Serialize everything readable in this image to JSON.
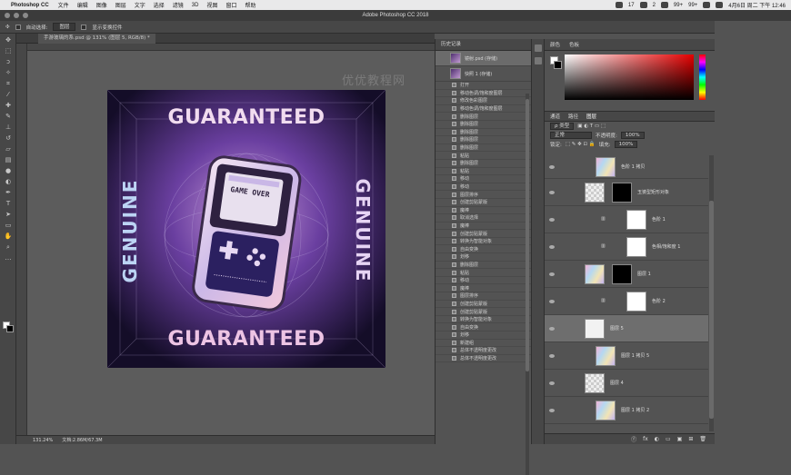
{
  "menubar": {
    "app": "Photoshop CC",
    "items": [
      "文件",
      "编辑",
      "图像",
      "图层",
      "文字",
      "选择",
      "滤镜",
      "3D",
      "视图",
      "窗口",
      "帮助"
    ],
    "status": [
      "17",
      "2",
      "99+",
      "99+"
    ],
    "clock": "4月6日 周二 下午 12:46"
  },
  "window": {
    "title": "Adobe Photoshop CC 2018"
  },
  "options": {
    "auto_select": "自动选择:",
    "layer_select": "图层",
    "show_transform": "显示变换控件"
  },
  "document": {
    "tab": "手游玻璃的系.psd @ 131% (图层 5, RGB/8) *",
    "zoom": "131.24%",
    "doc_size": "文档:2.86M/67.3M"
  },
  "artwork": {
    "top_text": "GUARANTEED",
    "bottom_text": "GUARANTEED",
    "left_text": "GENUINE",
    "right_text": "GENUINE",
    "screen_text": "GAME OVER"
  },
  "watermark": "优优教程网",
  "history": {
    "title": "历史记录",
    "snapshots": [
      "镜射.psd (存储)",
      "快照 1 (存储)"
    ],
    "steps": [
      "打开",
      "移动色调/饱和度图层",
      "修改色彩图层",
      "移动色调/饱和度图层",
      "删除图层",
      "删除图层",
      "删除图层",
      "删除图层",
      "删除图层",
      "粘贴",
      "删除图层",
      "粘贴",
      "移动",
      "移动",
      "图层排序",
      "创建剪贴蒙版",
      "魔棒",
      "取消选择",
      "魔棒",
      "创建剪贴蒙版",
      "转换为智能对象",
      "自由变换",
      "划移",
      "删除图层",
      "粘贴",
      "移动",
      "魔棒",
      "图层排序",
      "创建剪贴蒙版",
      "创建剪贴蒙版",
      "转换为智能对象",
      "自由变换",
      "划移",
      "新建组",
      "总体不透明度更改",
      "总体不透明度更改"
    ]
  },
  "colorpanel": {
    "tabs": [
      "颜色",
      "色板"
    ],
    "hue_accent": "#e60000"
  },
  "layerspanel": {
    "tabs": [
      "通道",
      "路径",
      "图层"
    ],
    "kind": "ρ 类型",
    "blend": "正常",
    "opacity_label": "不透明度:",
    "opacity": "100%",
    "lock_label": "锁定:",
    "fill_label": "填充:",
    "fill": "100%",
    "layers": [
      "色阶 1 拷贝",
      "玉婆型矩形对象",
      "色阶 1",
      "色相/饱和度 1",
      "图层 1",
      "色阶 2",
      "图层 5",
      "图层 1 拷贝 5",
      "图层 4",
      "图层 1 拷贝 2"
    ],
    "footer": [
      "ⓕ",
      "fx",
      "◐",
      "▭",
      "▣",
      "⊞",
      "🗑"
    ]
  }
}
